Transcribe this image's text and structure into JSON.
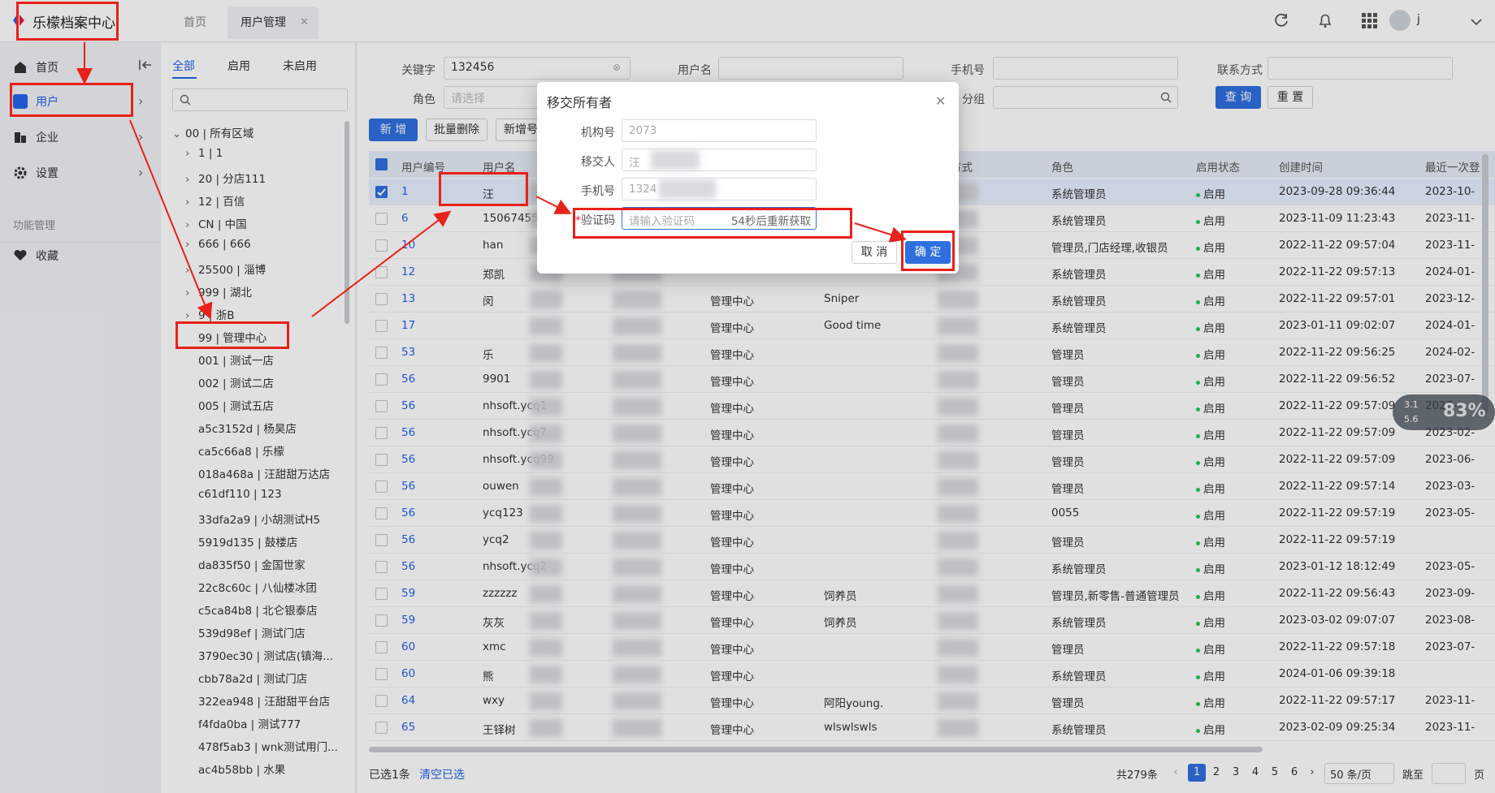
{
  "app": {
    "title": "乐檬档案中心"
  },
  "tabs": {
    "home": "首页",
    "active": "用户管理"
  },
  "topbar": {
    "user": "j"
  },
  "nav": {
    "items": [
      {
        "label": "首页"
      },
      {
        "label": "用户"
      },
      {
        "label": "企业"
      },
      {
        "label": "设置"
      }
    ],
    "section": "功能管理",
    "favorites": "收藏"
  },
  "tree": {
    "tabs": [
      "全部",
      "启用",
      "未启用"
    ],
    "nodes": [
      "00 | 所有区域",
      "1 | 1",
      "20 | 分店111",
      "12 | 百信",
      "CN | 中国",
      "666 | 666",
      "25500 | 淄博",
      "999 | 湖北",
      "9 | 浙B",
      "99 | 管理中心",
      "001 | 测试一店",
      "002 | 测试二店",
      "005 | 测试五店",
      "a5c3152d | 杨昊店",
      "ca5c66a8 | 乐檬",
      "018a468a | 汪甜甜万达店",
      "c61df110 | 123",
      "33dfa2a9 | 小胡测试H5",
      "5919d135 | 鼓楼店",
      "da835f50 | 金国世家",
      "22c8c60c | 八仙楼冰团",
      "c5ca84b8 | 北仑银泰店",
      "539d98ef | 测试门店",
      "3790ec30 | 测试店(镇海...",
      "cbb78a2d | 测试门店",
      "322ea948 | 汪甜甜平台店",
      "f4fda0ba | 测试777",
      "478f5ab3 | wnk测试用门...",
      "ac4b58bb | 水果"
    ]
  },
  "filters": {
    "keyword_label": "关键字",
    "keyword_value": "132456",
    "username_label": "用户名",
    "phone_label": "手机号",
    "contact_label": "联系方式",
    "role_label": "角色",
    "role_placeholder": "请选择",
    "group_label": "分组",
    "query": "查 询",
    "reset": "重 置"
  },
  "toolbar": {
    "add": "新 增",
    "batch_delete": "批量删除",
    "add_number": "新增号"
  },
  "table": {
    "headers": [
      "用户编号",
      "用户名",
      "方式",
      "角色",
      "启用状态",
      "创建时间",
      "最近一次登"
    ],
    "rows": [
      {
        "id": "1",
        "name": "汪",
        "col3": "",
        "col4": "",
        "role": "系统管理员",
        "status": "启用",
        "created": "2023-09-28 09:36:44",
        "last": "2023-10-",
        "sel": true
      },
      {
        "id": "6",
        "name": "15067455",
        "col3": "",
        "col4": "",
        "role": "系统管理员",
        "status": "启用",
        "created": "2023-11-09 11:23:43",
        "last": "2023-11-"
      },
      {
        "id": "10",
        "name": "han",
        "col3": "",
        "col4": "",
        "role": "管理员,门店经理,收银员",
        "status": "启用",
        "created": "2022-11-22 09:57:04",
        "last": "2023-11-"
      },
      {
        "id": "12",
        "name": "郑凯",
        "col3": "",
        "col4": "",
        "role": "系统管理员",
        "status": "启用",
        "created": "2022-11-22 09:57:13",
        "last": "2024-01-"
      },
      {
        "id": "13",
        "name": "闵",
        "col3": "管理中心",
        "col4": "Sniper",
        "role": "系统管理员",
        "status": "启用",
        "created": "2022-11-22 09:57:01",
        "last": "2023-12-"
      },
      {
        "id": "17",
        "name": "",
        "col3": "管理中心",
        "col4": "Good time",
        "role": "系统管理员",
        "status": "启用",
        "created": "2023-01-11 09:02:07",
        "last": "2024-01-"
      },
      {
        "id": "53",
        "name": "乐",
        "col3": "管理中心",
        "col4": "",
        "role": "管理员",
        "status": "启用",
        "created": "2022-11-22 09:56:25",
        "last": "2024-02-"
      },
      {
        "id": "56",
        "name": "9901",
        "col3": "管理中心",
        "col4": "",
        "role": "管理员",
        "status": "启用",
        "created": "2022-11-22 09:56:52",
        "last": "2023-07-"
      },
      {
        "id": "56",
        "name": "nhsoft.ycq1",
        "col3": "管理中心",
        "col4": "",
        "role": "管理员",
        "status": "启用",
        "created": "2022-11-22 09:57:09",
        "last": "2023-"
      },
      {
        "id": "56",
        "name": "nhsoft.ycq7",
        "col3": "管理中心",
        "col4": "",
        "role": "管理员",
        "status": "启用",
        "created": "2022-11-22 09:57:09",
        "last": "2023-02-"
      },
      {
        "id": "56",
        "name": "nhsoft.ycq99",
        "col3": "管理中心",
        "col4": "",
        "role": "管理员",
        "status": "启用",
        "created": "2022-11-22 09:57:09",
        "last": "2023-06-"
      },
      {
        "id": "56",
        "name": "ouwen",
        "col3": "管理中心",
        "col4": "",
        "role": "管理员",
        "status": "启用",
        "created": "2022-11-22 09:57:14",
        "last": "2023-03-"
      },
      {
        "id": "56",
        "name": "ycq123",
        "col3": "管理中心",
        "col4": "",
        "role": "0055",
        "status": "启用",
        "created": "2022-11-22 09:57:19",
        "last": "2023-05-"
      },
      {
        "id": "56",
        "name": "ycq2",
        "col3": "管理中心",
        "col4": "",
        "role": "管理员",
        "status": "启用",
        "created": "2022-11-22 09:57:19",
        "last": ""
      },
      {
        "id": "56",
        "name": "nhsoft.ycq2",
        "col3": "管理中心",
        "col4": "",
        "role": "系统管理员",
        "status": "启用",
        "created": "2023-01-12 18:12:49",
        "last": "2023-05-"
      },
      {
        "id": "59",
        "name": "zzzzzz",
        "col3": "管理中心",
        "col4": "饲养员",
        "role": "管理员,新零售-普通管理员",
        "status": "启用",
        "created": "2022-11-22 09:56:43",
        "last": "2023-09-"
      },
      {
        "id": "59",
        "name": "灰灰",
        "col3": "管理中心",
        "col4": "饲养员",
        "role": "系统管理员",
        "status": "启用",
        "created": "2023-03-02 09:07:07",
        "last": "2023-08-"
      },
      {
        "id": "60",
        "name": "xmc",
        "col3": "管理中心",
        "col4": "",
        "role": "管理员",
        "status": "启用",
        "created": "2022-11-22 09:57:18",
        "last": "2023-07-"
      },
      {
        "id": "60",
        "name": "熊",
        "col3": "管理中心",
        "col4": "",
        "role": "系统管理员",
        "status": "启用",
        "created": "2024-01-06 09:39:18",
        "last": ""
      },
      {
        "id": "64",
        "name": "wxy",
        "col3": "管理中心",
        "col4": "阿阳young.",
        "role": "管理员",
        "status": "启用",
        "created": "2022-11-22 09:57:17",
        "last": "2023-11-"
      },
      {
        "id": "65",
        "name": "王铎树",
        "col3": "管理中心",
        "col4": "wlswlswls",
        "role": "系统管理员",
        "status": "启用",
        "created": "2023-02-09 09:25:34",
        "last": "2023-11-"
      }
    ]
  },
  "footer": {
    "selected": "已选1条",
    "clear": "清空已选",
    "total": "共279条",
    "pages": [
      "1",
      "2",
      "3",
      "4",
      "5",
      "6"
    ],
    "page_size": "50 条/页",
    "goto": "跳至",
    "page_unit": "页"
  },
  "modal": {
    "title": "移交所有者",
    "org_label": "机构号",
    "org_value": "2073",
    "transferor_label": "移交人",
    "transferor_value": "汪",
    "phone_label": "手机号",
    "phone_value": "1324",
    "code_label": "验证码",
    "code_placeholder": "请输入验证码",
    "code_resend": "54秒后重新获取",
    "cancel": "取 消",
    "confirm": "确 定"
  },
  "hud": {
    "up": "3.1",
    "down": "5.6",
    "percent": "83%"
  }
}
